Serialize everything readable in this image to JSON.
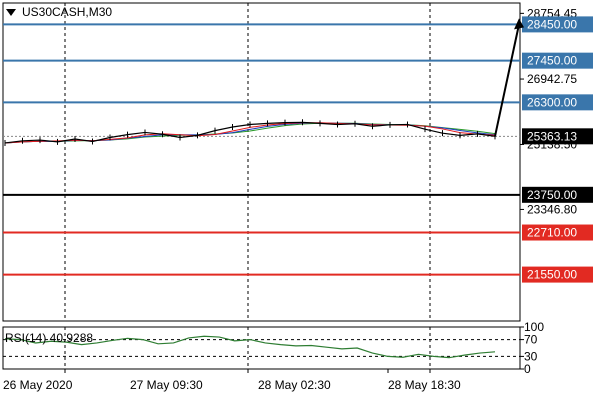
{
  "header": {
    "symbol_timeframe": "US30CASH,M30",
    "menu_icon": "triangle-down-icon"
  },
  "colors": {
    "blue_level": "#3a76ab",
    "black_level": "#000000",
    "red_level": "#e22a22",
    "price_line": "#000000",
    "ma_fast": "#e41a1c",
    "ma_mid": "#1f3fbf",
    "ma_slow": "#2a9a2a",
    "rsi_line": "#2e7d32",
    "grid": "#000000"
  },
  "chart_data": [
    {
      "type": "line",
      "title": "US30CASH,M30",
      "x": [
        "26 May 2020",
        "27 May 09:30",
        "28 May 02:30",
        "28 May 18:30"
      ],
      "ylim": [
        20270,
        29040
      ],
      "y_ticks": [
        "28754.45",
        "26942.75",
        "25138.50",
        "23346.80"
      ],
      "series": [
        {
          "name": "price",
          "values": [
            25180,
            25240,
            25260,
            25210,
            25290,
            25220,
            25330,
            25410,
            25470,
            25420,
            25330,
            25390,
            25520,
            25620,
            25690,
            25720,
            25740,
            25750,
            25720,
            25690,
            25710,
            25640,
            25680,
            25690,
            25560,
            25450,
            25390,
            25430,
            25363.13
          ]
        }
      ],
      "levels": [
        {
          "label": "28450.00",
          "value": 28450.0,
          "color": "blue"
        },
        {
          "label": "27450.00",
          "value": 27450.0,
          "color": "blue"
        },
        {
          "label": "26300.00",
          "value": 26300.0,
          "color": "blue"
        },
        {
          "label": "23750.00",
          "value": 23750.0,
          "color": "black"
        },
        {
          "label": "22710.00",
          "value": 22710.0,
          "color": "red"
        },
        {
          "label": "21550.00",
          "value": 21550.0,
          "color": "red"
        }
      ],
      "current_price": {
        "label": "25363.13",
        "value": 25363.13
      },
      "projection": {
        "from": 25363.13,
        "to": 28450.0
      }
    },
    {
      "type": "line",
      "title": "RSI(14) 40.9288",
      "ylim": [
        0,
        100
      ],
      "y_ticks": [
        "100",
        "70",
        "30",
        "0"
      ],
      "levels": [
        70,
        30
      ],
      "series": [
        {
          "name": "RSI(14)",
          "values": [
            72,
            70,
            62,
            66,
            64,
            58,
            62,
            68,
            73,
            70,
            60,
            62,
            74,
            78,
            76,
            67,
            70,
            62,
            58,
            55,
            56,
            52,
            48,
            50,
            38,
            30,
            28,
            35,
            30,
            27,
            33,
            38,
            40.9
          ]
        }
      ]
    }
  ],
  "axes": {
    "x_labels": [
      "26 May 2020",
      "27 May 09:30",
      "28 May 02:30",
      "28 May 18:30"
    ]
  }
}
